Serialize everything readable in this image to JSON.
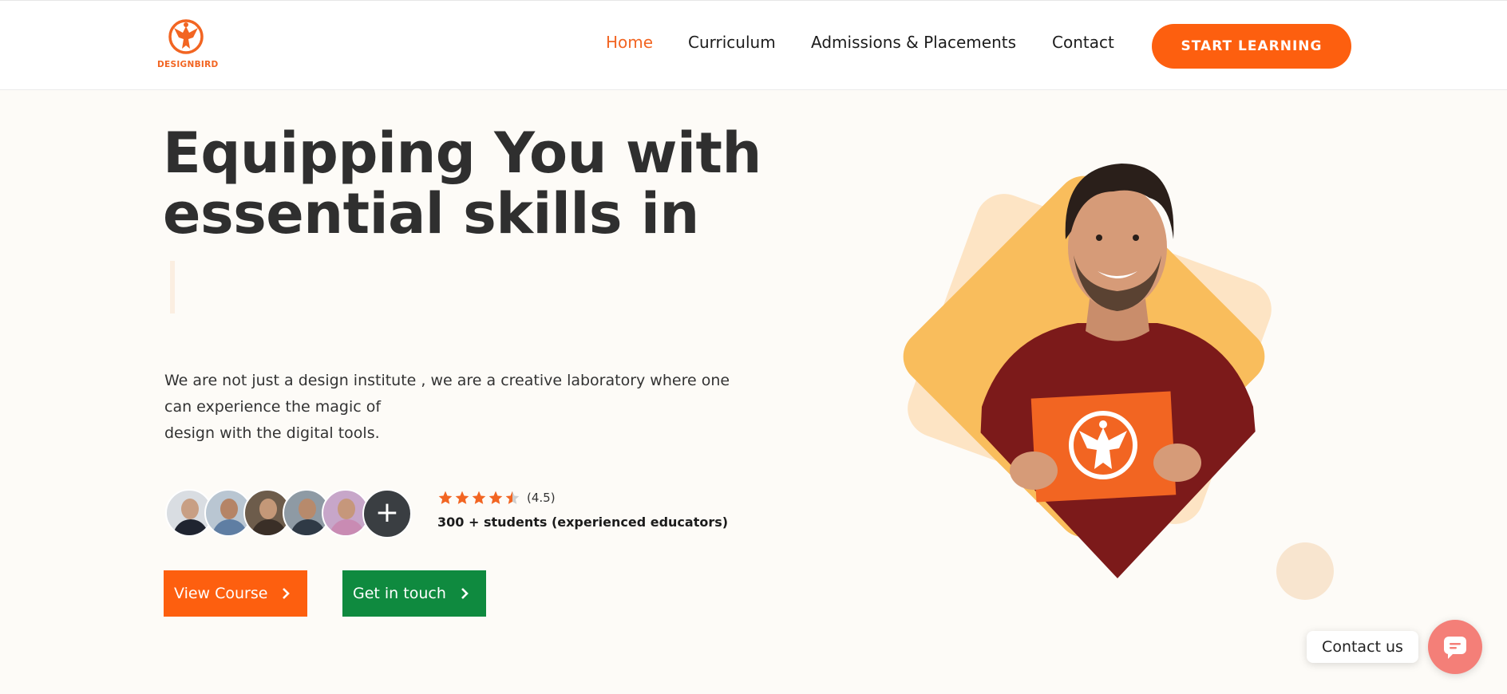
{
  "brand": {
    "name": "DESIGNBIRD",
    "accent": "#fd5f0f",
    "green": "#0f8a3f"
  },
  "nav": {
    "items": [
      {
        "label": "Home",
        "active": true
      },
      {
        "label": "Curriculum",
        "active": false
      },
      {
        "label": "Admissions & Placements",
        "active": false
      },
      {
        "label": "Contact",
        "active": false
      }
    ],
    "cta_label": "START LEARNING"
  },
  "hero": {
    "headline_line1": "Equipping You with",
    "headline_line2": "essential skills in",
    "description_line1": "We are not just a design institute , we are a creative laboratory where one",
    "description_line2": "can experience the magic of",
    "description_line3": "design with the digital tools.",
    "rating": {
      "stars": 4.5,
      "value_text": "(4.5)"
    },
    "students_text": "300 + students (experienced educators)",
    "avatar_plus": "+",
    "buttons": {
      "view_course": "View Course",
      "get_in_touch": "Get in touch"
    }
  },
  "widget": {
    "contact_label": "Contact us"
  },
  "icons": [
    "eagle-logo-icon",
    "star-icon",
    "chevron-right-icon",
    "chat-icon",
    "plus-icon"
  ]
}
